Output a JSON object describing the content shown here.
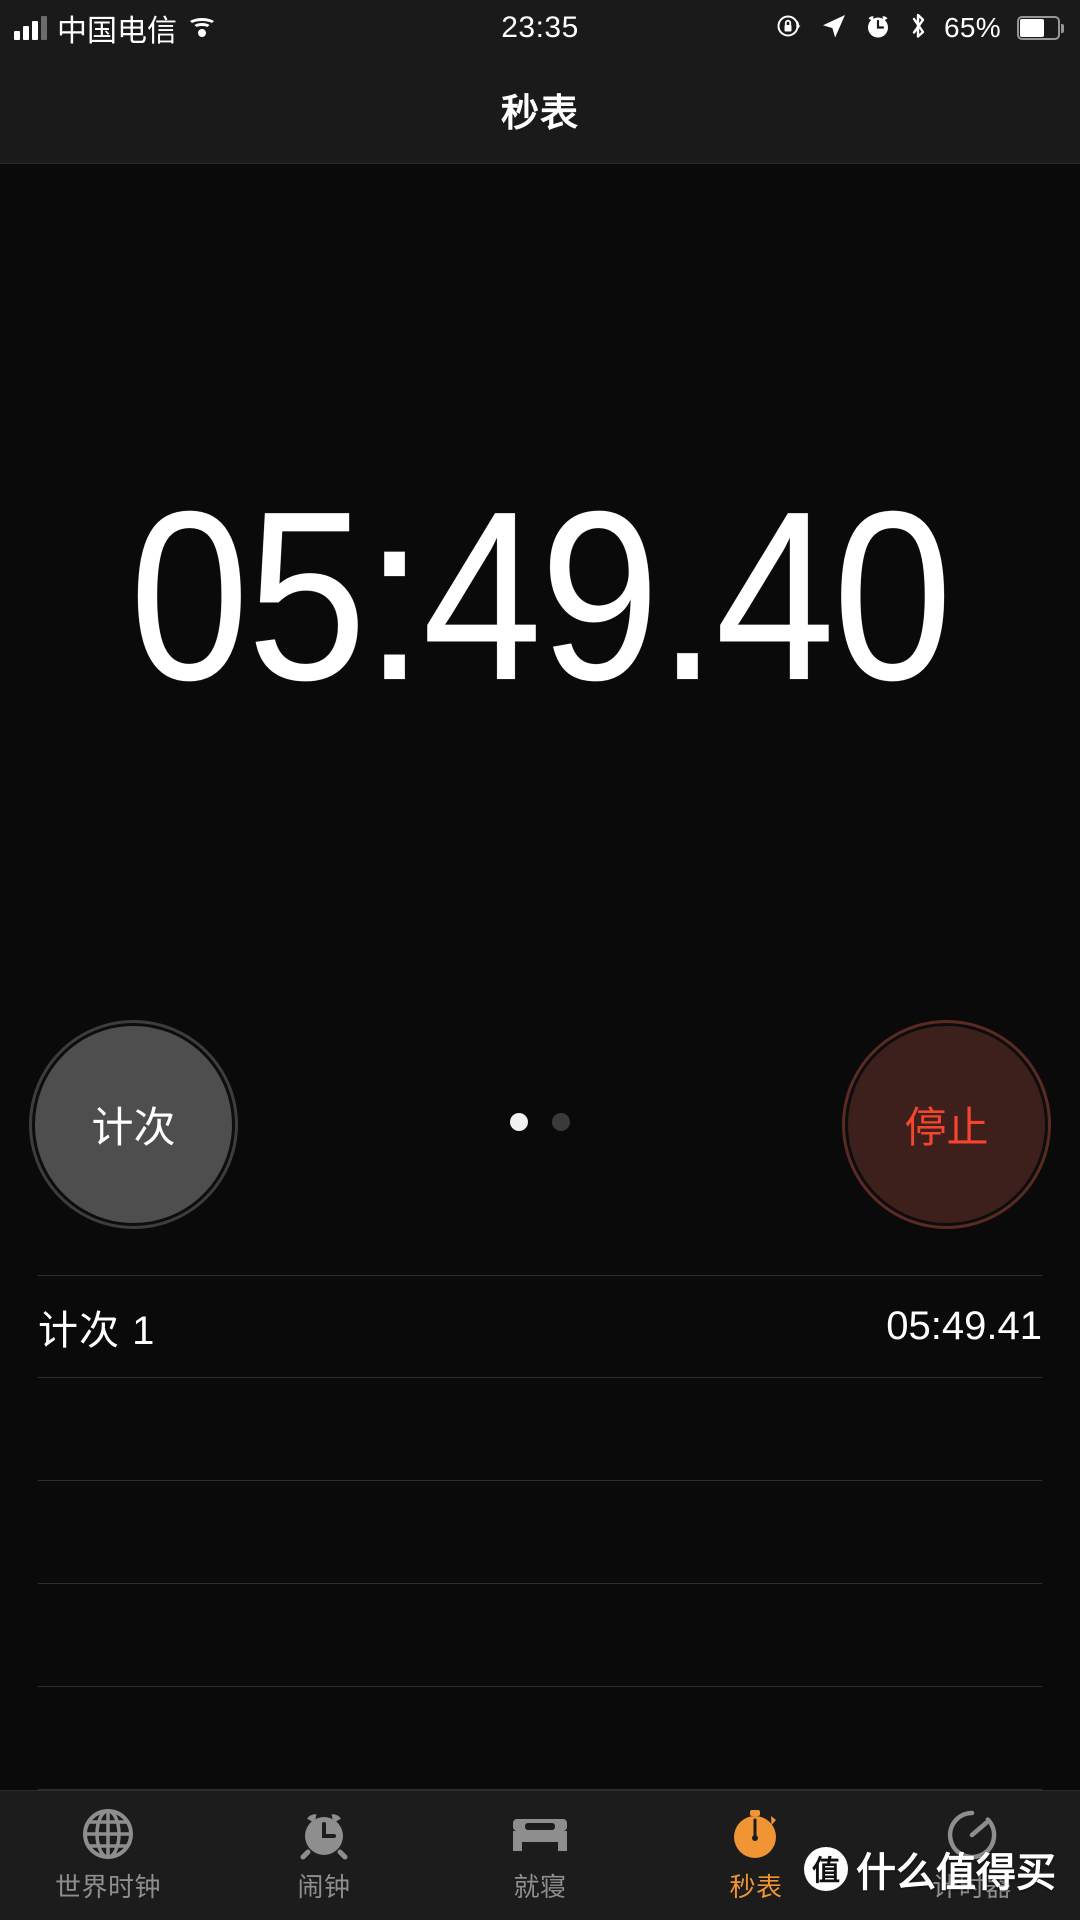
{
  "status_bar": {
    "signal_icon": "signal-bars-icon",
    "carrier": "中国电信",
    "wifi_icon": "wifi-icon",
    "time": "23:35",
    "rotation_lock_icon": "rotation-lock-icon",
    "location_icon": "location-arrow-icon",
    "alarm_icon": "alarm-clock-icon",
    "bluetooth_icon": "bluetooth-icon",
    "battery_percent": "65%",
    "battery_icon": "battery-icon",
    "battery_level": 65
  },
  "nav": {
    "title": "秒表"
  },
  "stopwatch": {
    "elapsed": "05:49.40"
  },
  "controls": {
    "lap_label": "计次",
    "stop_label": "停止",
    "page_dots": 2,
    "active_dot": 0
  },
  "laps": {
    "rows": [
      {
        "label": "计次 1",
        "time": "05:49.41"
      },
      {
        "label": "",
        "time": ""
      },
      {
        "label": "",
        "time": ""
      },
      {
        "label": "",
        "time": ""
      },
      {
        "label": "",
        "time": ""
      }
    ]
  },
  "tabs": [
    {
      "label": "世界时钟",
      "icon": "globe-icon",
      "active": false
    },
    {
      "label": "闹钟",
      "icon": "alarm-clock-icon",
      "active": false
    },
    {
      "label": "就寝",
      "icon": "bed-icon",
      "active": false
    },
    {
      "label": "秒表",
      "icon": "stopwatch-icon",
      "active": true
    },
    {
      "label": "计时器",
      "icon": "timer-icon",
      "active": false
    }
  ],
  "watermark": {
    "badge": "值",
    "text": "什么值得买"
  },
  "colors": {
    "background": "#0a0a0a",
    "chrome": "#1a1a1a",
    "tabbar": "#1c1c1c",
    "accent": "#f09434",
    "stop_text": "#f6452e",
    "stop_fill": "#3d1f1b",
    "lap_fill": "#4e4e4e",
    "separator": "#2e2e2e",
    "inactive_tab": "#8e8e8e"
  }
}
